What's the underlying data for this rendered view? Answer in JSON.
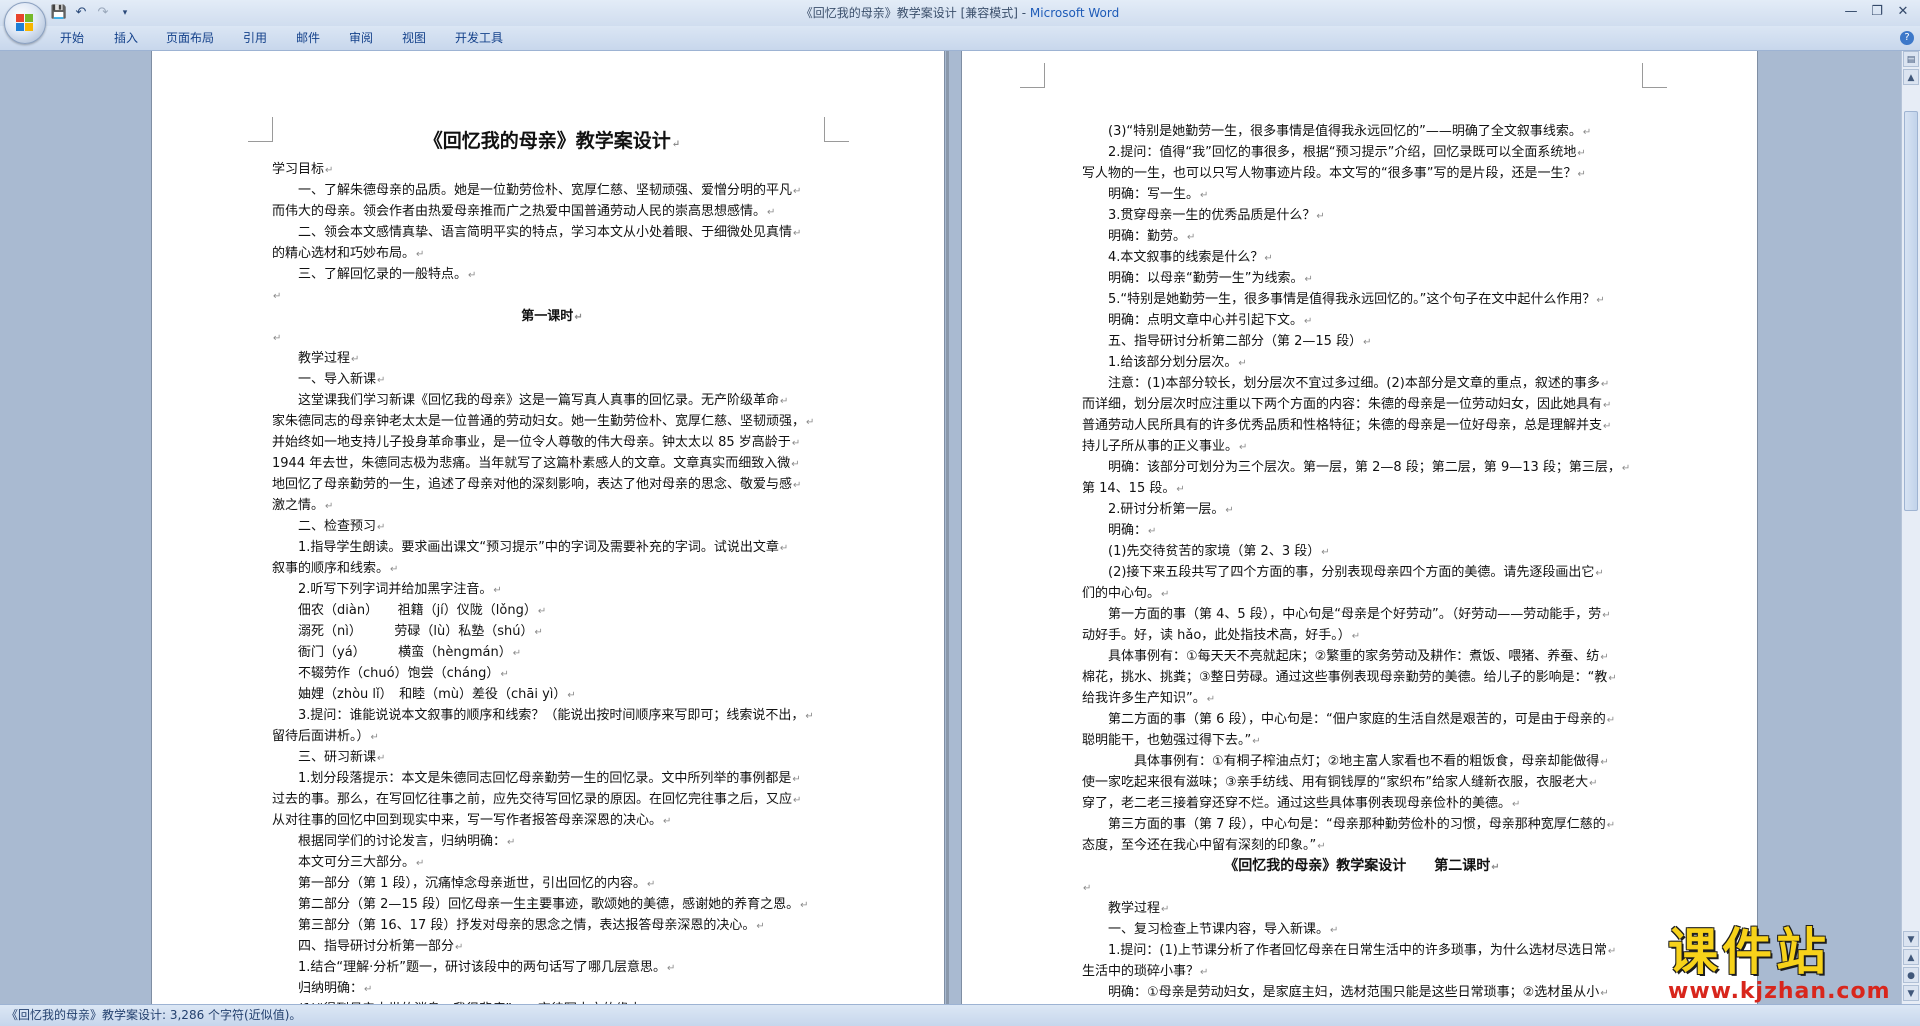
{
  "window": {
    "title": "《回忆我的母亲》教学案设计 [兼容模式] - ",
    "app": "Microsoft Word"
  },
  "quick_access": {
    "save_icon": "save-icon",
    "undo_icon": "undo-icon",
    "redo_icon": "redo-icon",
    "customize_icon": "chevron-down-icon"
  },
  "ribbon_tabs": [
    "开始",
    "插入",
    "页面布局",
    "引用",
    "邮件",
    "审阅",
    "视图",
    "开发工具"
  ],
  "colors": {
    "accent": "#15428b",
    "ribbon_bg": "#c8d7ec",
    "workspace_bg": "#a9bad1",
    "watermark_yellow": "#f7d21a",
    "watermark_red": "#d8261c"
  },
  "left_page": {
    "lines": [
      {
        "t": "《回忆我的母亲》教学案设计",
        "s": "title"
      },
      {
        "t": "学习目标"
      },
      {
        "t": "　　一、了解朱德母亲的品质。她是一位勤劳俭朴、宽厚仁慈、坚韧顽强、爱憎分明的平凡"
      },
      {
        "t": "而伟大的母亲。领会作者由热爱母亲推而广之热爱中国普通劳动人民的崇高思想感情。"
      },
      {
        "t": "　　二、领会本文感情真挚、语言简明平实的特点，学习本文从小处着眼、于细微处见真情"
      },
      {
        "t": "的精心选材和巧妙布局。"
      },
      {
        "t": "　　三、了解回忆录的一般特点。"
      },
      {
        "t": ""
      },
      {
        "t": "第一课时",
        "s": "center"
      },
      {
        "t": ""
      },
      {
        "t": "　　教学过程"
      },
      {
        "t": "　　一、导入新课"
      },
      {
        "t": "　　这堂课我们学习新课《回忆我的母亲》这是一篇写真人真事的回忆录。无产阶级革命"
      },
      {
        "t": "家朱德同志的母亲钟老太太是一位普通的劳动妇女。她一生勤劳俭朴、宽厚仁慈、坚韧顽强，"
      },
      {
        "t": "并始终如一地支持儿子投身革命事业，是一位令人尊敬的伟大母亲。钟太太以 85 岁高龄于"
      },
      {
        "t": "1944 年去世，朱德同志极为悲痛。当年就写了这篇朴素感人的文章。文章真实而细致入微"
      },
      {
        "t": "地回忆了母亲勤劳的一生，追述了母亲对他的深刻影响，表达了他对母亲的思念、敬爱与感"
      },
      {
        "t": "激之情。"
      },
      {
        "t": "　　二、检查预习"
      },
      {
        "t": "　　1.指导学生朗读。要求画出课文“预习提示”中的字词及需要补充的字词。试说出文章"
      },
      {
        "t": "叙事的顺序和线索。"
      },
      {
        "t": "　　2.听写下列字词并给加黑字注音。"
      },
      {
        "t": "　　佃农（diàn）　　祖籍（jí）仪陇（lǒng）"
      },
      {
        "t": "　　溺死（nì）　　　劳碌（lù）私塾（shú）"
      },
      {
        "t": "　　衙门（yá）　　　横蛮（hèngmán）"
      },
      {
        "t": "　　不辍劳作（chuó）饱尝（cháng）"
      },
      {
        "t": "　　妯娌（zhòu lǐ）　和睦（mù）差役（chāi yì）"
      },
      {
        "t": "　　3.提问：谁能说说本文叙事的顺序和线索？（能说出按时间顺序来写即可；线索说不出，"
      },
      {
        "t": "留待后面讲析。）"
      },
      {
        "t": "　　三、研习新课"
      },
      {
        "t": "　　1.划分段落提示：本文是朱德同志回忆母亲勤劳一生的回忆录。文中所列举的事例都是"
      },
      {
        "t": "过去的事。那么，在写回忆往事之前，应先交待写回忆录的原因。在回忆完往事之后，又应"
      },
      {
        "t": "从对往事的回忆中回到现实中来，写一写作者报答母亲深恩的决心。"
      },
      {
        "t": "　　根据同学们的讨论发言，归纳明确："
      },
      {
        "t": "　　本文可分三大部分。"
      },
      {
        "t": "　　第一部分（第 1 段），沉痛悼念母亲逝世，引出回忆的内容。"
      },
      {
        "t": "　　第二部分（第 2—15 段）回忆母亲一生主要事迹，歌颂她的美德，感谢她的养育之恩。"
      },
      {
        "t": "　　第三部分（第 16、17 段）抒发对母亲的思念之情，表达报答母亲深恩的决心。"
      },
      {
        "t": "　　四、指导研讨分析第一部分"
      },
      {
        "t": "　　1.结合“理解·分析”题一，研讨该段中的两句话写了哪几层意思。"
      },
      {
        "t": "　　归纳明确："
      },
      {
        "t": "　　(1)“得到母亲去世的消息，我很悲痛”——交待写本文的缘由。"
      }
    ]
  },
  "right_page": {
    "lines": [
      {
        "t": "　　(3)“特别是她勤劳一生，很多事情是值得我永远回忆的”——明确了全文叙事线索。"
      },
      {
        "t": "　　2.提问：值得“我”回忆的事很多，根据“预习提示”介绍，回忆录既可以全面系统地"
      },
      {
        "t": "写人物的一生，也可以只写人物事迹片段。本文写的“很多事”写的是片段，还是一生？"
      },
      {
        "t": "　　明确：写一生。"
      },
      {
        "t": "　　3.贯穿母亲一生的优秀品质是什么？"
      },
      {
        "t": "　　明确：勤劳。"
      },
      {
        "t": "　　4.本文叙事的线索是什么？"
      },
      {
        "t": "　　明确：以母亲“勤劳一生”为线索。"
      },
      {
        "t": "　　5.“特别是她勤劳一生，很多事情是值得我永远回忆的。”这个句子在文中起什么作用？"
      },
      {
        "t": "　　明确：点明文章中心并引起下文。"
      },
      {
        "t": "　　五、指导研讨分析第二部分（第 2—15 段）"
      },
      {
        "t": "　　1.给该部分划分层次。"
      },
      {
        "t": "　　注意：(1)本部分较长，划分层次不宜过多过细。(2)本部分是文章的重点，叙述的事多"
      },
      {
        "t": "而详细，划分层次时应注重以下两个方面的内容：朱德的母亲是一位劳动妇女，因此她具有"
      },
      {
        "t": "普通劳动人民所具有的许多优秀品质和性格特征；朱德的母亲是一位好母亲，总是理解并支"
      },
      {
        "t": "持儿子所从事的正义事业。"
      },
      {
        "t": "　　明确：该部分可划分为三个层次。第一层，第 2—8 段；第二层，第 9—13 段；第三层，"
      },
      {
        "t": "第 14、15 段。"
      },
      {
        "t": "　　2.研讨分析第一层。"
      },
      {
        "t": "　　明确："
      },
      {
        "t": "　　(1)先交待贫苦的家境（第 2、3 段）"
      },
      {
        "t": "　　(2)接下来五段共写了四个方面的事，分别表现母亲四个方面的美德。请先逐段画出它"
      },
      {
        "t": "们的中心句。"
      },
      {
        "t": "　　第一方面的事（第 4、5 段），中心句是“母亲是个好劳动”。（好劳动——劳动能手，劳"
      },
      {
        "t": "动好手。好，读 hǎo，此处指技术高，好手。）"
      },
      {
        "t": "　　具体事例有：①每天天不亮就起床；②繁重的家务劳动及耕作：煮饭、喂猪、养蚕、纺"
      },
      {
        "t": "棉花，挑水、挑粪；③整日劳碌。通过这些事例表现母亲勤劳的美德。给儿子的影响是：“教"
      },
      {
        "t": "给我许多生产知识”。"
      },
      {
        "t": "　　第二方面的事（第 6 段），中心句是：“佃户家庭的生活自然是艰苦的，可是由于母亲的"
      },
      {
        "t": "聪明能干，也勉强过得下去。”"
      },
      {
        "t": "　　　　具体事例有：①有桐子榨油点灯；②地主富人家看也不看的粗饭食，母亲却能做得"
      },
      {
        "t": "使一家吃起来很有滋味；③亲手纺线、用有铜钱厚的“家织布”给家人缝新衣服，衣服老大"
      },
      {
        "t": "穿了，老二老三接着穿还穿不烂。通过这些具体事例表现母亲俭朴的美德。"
      },
      {
        "t": "　　第三方面的事（第 7 段），中心句是：“母亲那种勤劳俭朴的习惯，母亲那种宽厚仁慈的"
      },
      {
        "t": "态度，至今还在我心中留有深刻的印象。”"
      },
      {
        "t": "《回忆我的母亲》教学案设计　　第二课时",
        "s": "h2"
      },
      {
        "t": ""
      },
      {
        "t": "　　教学过程"
      },
      {
        "t": "　　一、复习检查上节课内容，导入新课。"
      },
      {
        "t": "　　1.提问：(1)上节课分析了作者回忆母亲在日常生活中的许多琐事，为什么选材尽选日常"
      },
      {
        "t": "生活中的琐碎小事？"
      },
      {
        "t": "　　明确：①母亲是劳动妇女，是家庭主妇，选材范围只能是这些日常琐事；②选材虽从小"
      },
      {
        "t": "处着眼，但能于细微处见真情，写得真实、亲切、感人。这正是本文在选材方面的突出之处。"
      }
    ]
  },
  "status_bar": {
    "text": "《回忆我的母亲》教学案设计: 3,286 个字符(近似值)。"
  },
  "watermark": {
    "logo_text": "课件站",
    "url": "www.kjzhan.com"
  }
}
